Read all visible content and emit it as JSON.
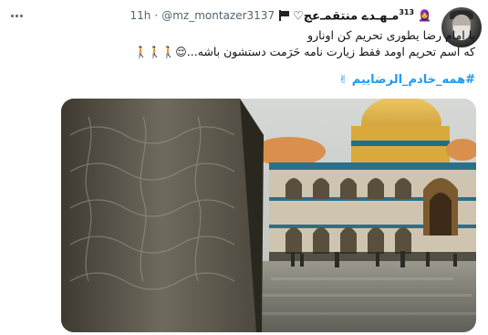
{
  "tweet": {
    "more_icon": "more-horizontal-icon",
    "handle": "@mz_montazer3137",
    "separator": "·",
    "time": "11h",
    "display_name": "مـهـدے منتقمـ‌عج♡",
    "name_superscript": "313",
    "name_icons": [
      "flag-icon",
      "woman-icon"
    ],
    "text_line_1": "با امام رضا یطوری تحریم کن اونارو",
    "text_line_2": "که اسم تحریم اومد فقط زیارت نامه حَرَمت دستشون باشه...",
    "emoji_line_2": "😌🚶🚶🚶",
    "hashtag": "#همه_خادم_الرضاییم",
    "hashtag_emoji": "✌",
    "media_alt": "shrine-courtyard-photo"
  },
  "colors": {
    "text": "#0f1419",
    "secondary": "#536471",
    "link": "#1d9bf0"
  }
}
